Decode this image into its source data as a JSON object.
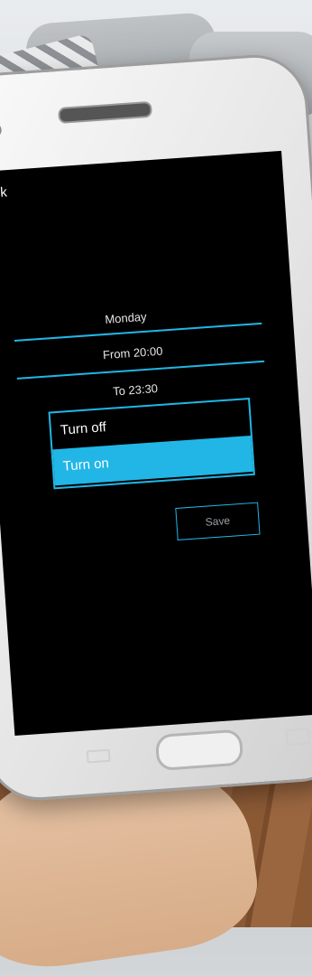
{
  "screen": {
    "back_label": "Back",
    "day": "Monday",
    "from": "From 20:00",
    "to": "To 23:30",
    "options": [
      "Turn off",
      "Turn on"
    ],
    "selected_option": "Turn on",
    "save_label": "Save"
  },
  "colors": {
    "accent": "#21b6e6",
    "screen_bg": "#000000",
    "text": "#e6e6e6"
  }
}
